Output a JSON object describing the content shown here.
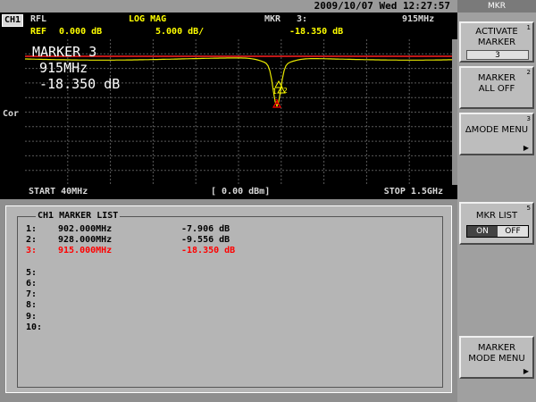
{
  "status": {
    "datetime": "2009/10/07 Wed 12:27:57"
  },
  "channel": {
    "label": "CH1",
    "format": "RFL",
    "scale_mode": "LOG MAG",
    "ref_label": "REF",
    "ref_value": "0.000 dB",
    "scale_div": "5.000 dB/",
    "marker_label": "MKR",
    "marker_number": "3:",
    "marker_freq": "915MHz",
    "marker_value": "-18.350 dB",
    "correction": "Cor"
  },
  "graph_overlay": {
    "title": "MARKER 3",
    "freq": "915MHz",
    "value": "-18.350 dB",
    "marker_tags": [
      "1",
      "2",
      "3"
    ]
  },
  "sweep": {
    "start": "START 40MHz",
    "ref_power": "[ 0.00 dBm]",
    "stop": "STOP 1.5GHz"
  },
  "marker_list": {
    "title": "CH1 MARKER LIST",
    "rows": [
      {
        "index": "1:",
        "freq": "902.000MHz",
        "value": "-7.906 dB"
      },
      {
        "index": "2:",
        "freq": "928.000MHz",
        "value": "-9.556 dB"
      },
      {
        "index": "3:",
        "freq": "915.000MHz",
        "value": "-18.350 dB"
      },
      {
        "index": "5:",
        "freq": "",
        "value": ""
      },
      {
        "index": "6:",
        "freq": "",
        "value": ""
      },
      {
        "index": "7:",
        "freq": "",
        "value": ""
      },
      {
        "index": "8:",
        "freq": "",
        "value": ""
      },
      {
        "index": "9:",
        "freq": "",
        "value": ""
      },
      {
        "index": "10:",
        "freq": "",
        "value": ""
      }
    ],
    "active_row": 2
  },
  "softkeys": {
    "header": "MKR",
    "activate_line1": "ACTIVATE",
    "activate_line2": "MARKER",
    "activate_value": "3",
    "activate_num": "1",
    "all_off_line1": "MARKER",
    "all_off_line2": "ALL OFF",
    "all_off_num": "2",
    "delta_mode": "ΔMODE MENU",
    "delta_num": "3",
    "mkr_list": "MKR LIST",
    "mkr_list_num": "5",
    "toggle_on": "ON",
    "toggle_off": "OFF",
    "mode_menu_line1": "MARKER",
    "mode_menu_line2": "MODE MENU"
  },
  "colors": {
    "trace": "#e8e800",
    "reference_line": "#ff2020",
    "marker_active": "#ff0000",
    "marker_inactive": "#ffff00"
  }
}
